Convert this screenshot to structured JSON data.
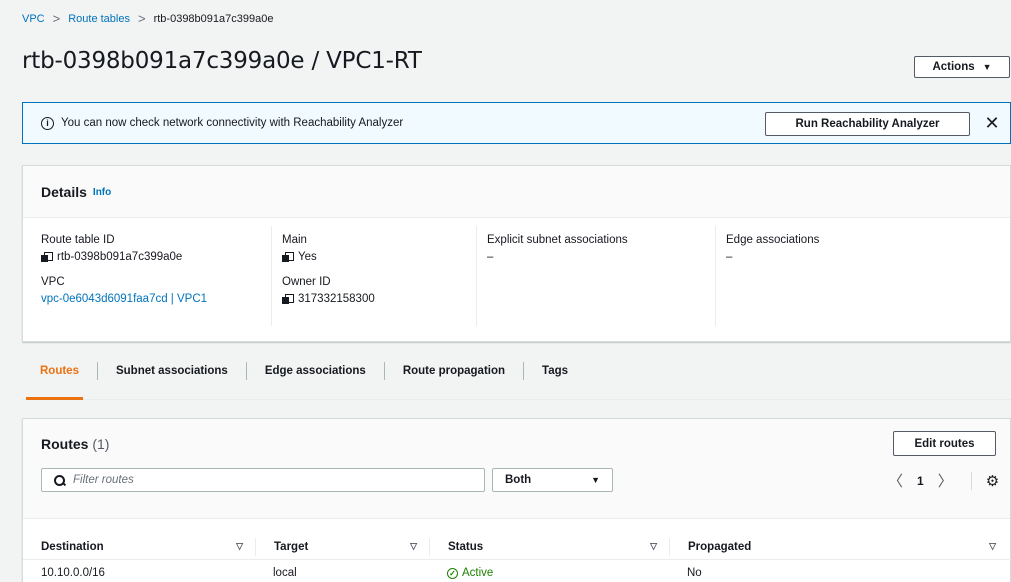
{
  "breadcrumb": {
    "items": [
      "VPC",
      "Route tables"
    ],
    "current": "rtb-0398b091a7c399a0e",
    "separator": ">"
  },
  "page": {
    "title": "rtb-0398b091a7c399a0e / VPC1-RT",
    "actions_label": "Actions",
    "actions_caret": "▼"
  },
  "flash": {
    "icon": "i",
    "message": "You can now check network connectivity with Reachability Analyzer",
    "button_label": "Run Reachability Analyzer",
    "close_glyph": "✕"
  },
  "details": {
    "heading": "Details",
    "info_label": "Info",
    "route_table_id_label": "Route table ID",
    "route_table_id": "rtb-0398b091a7c399a0e",
    "vpc_label": "VPC",
    "vpc_value": "vpc-0e6043d6091faa7cd | VPC1",
    "main_label": "Main",
    "main_value": "Yes",
    "owner_label": "Owner ID",
    "owner_value": "317332158300",
    "subnet_assoc_label": "Explicit subnet associations",
    "subnet_assoc_value": "–",
    "edge_assoc_label": "Edge associations",
    "edge_assoc_value": "–"
  },
  "tabs": [
    {
      "label": "Routes",
      "active": true
    },
    {
      "label": "Subnet associations",
      "active": false
    },
    {
      "label": "Edge associations",
      "active": false
    },
    {
      "label": "Route propagation",
      "active": false
    },
    {
      "label": "Tags",
      "active": false
    }
  ],
  "routes": {
    "title": "Routes",
    "count": "(1)",
    "edit_label": "Edit routes",
    "filter_placeholder": "Filter routes",
    "select_value": "Both",
    "select_caret": "▼",
    "page": "1",
    "prev_glyph": "〈",
    "next_glyph": "〉",
    "gear_glyph": "⚙",
    "columns": [
      {
        "label": "Destination",
        "sort": "▽"
      },
      {
        "label": "Target",
        "sort": "▽"
      },
      {
        "label": "Status",
        "sort": "▽"
      },
      {
        "label": "Propagated",
        "sort": "▽"
      }
    ],
    "rows": [
      {
        "destination": "10.10.0.0/16",
        "target": "local",
        "status": "Active",
        "propagated": "No"
      }
    ]
  },
  "colors": {
    "link": "#0073bb",
    "active_tab": "#ec7211",
    "success": "#1d8102",
    "flash_bg": "#f1faff"
  }
}
